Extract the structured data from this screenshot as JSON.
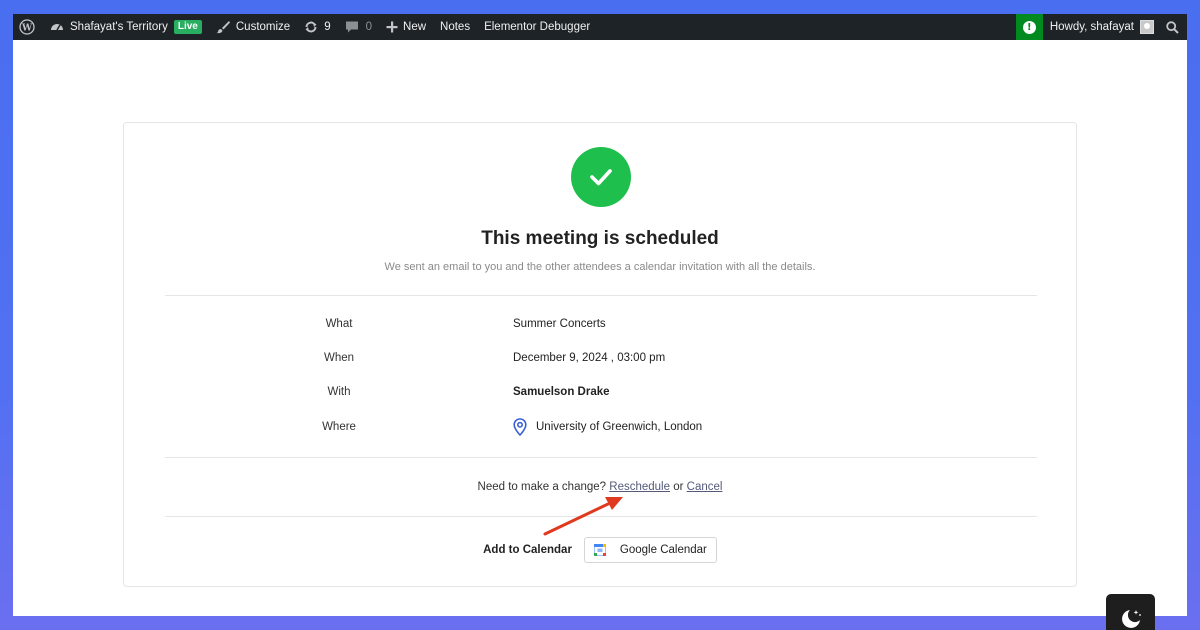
{
  "adminbar": {
    "site_name": "Shafayat's Territory",
    "live_badge": "Live",
    "customize": "Customize",
    "updates_count": "9",
    "comments_count": "0",
    "new_label": "New",
    "notes_label": "Notes",
    "debugger_label": "Elementor Debugger",
    "howdy": "Howdy, shafayat"
  },
  "confirmation": {
    "title": "This meeting is scheduled",
    "subtitle": "We sent an email to you and the other attendees a calendar invitation with all the details."
  },
  "details": {
    "what_label": "What",
    "what_value": "Summer Concerts",
    "when_label": "When",
    "when_value": "December 9, 2024 , 03:00 pm",
    "with_label": "With",
    "with_value": "Samuelson Drake",
    "where_label": "Where",
    "where_value": "University of Greenwich, London"
  },
  "change": {
    "prompt": "Need to make a change?",
    "reschedule": "Reschedule",
    "or": "or",
    "cancel": "Cancel"
  },
  "calendar": {
    "label": "Add to Calendar",
    "google_button": "Google Calendar"
  },
  "colors": {
    "success_green": "#1fbf4e",
    "admin_bar": "#1d2327",
    "annotation_arrow": "#e03a1e",
    "background_blue": "#4a6ef0"
  },
  "icons": [
    "wordpress-icon",
    "dashboard-icon",
    "brush-icon",
    "refresh-icon",
    "comment-icon",
    "plus-icon",
    "alert-icon",
    "avatar",
    "search-icon",
    "check-icon",
    "map-pin-icon",
    "google-calendar-icon",
    "moon-icon"
  ]
}
